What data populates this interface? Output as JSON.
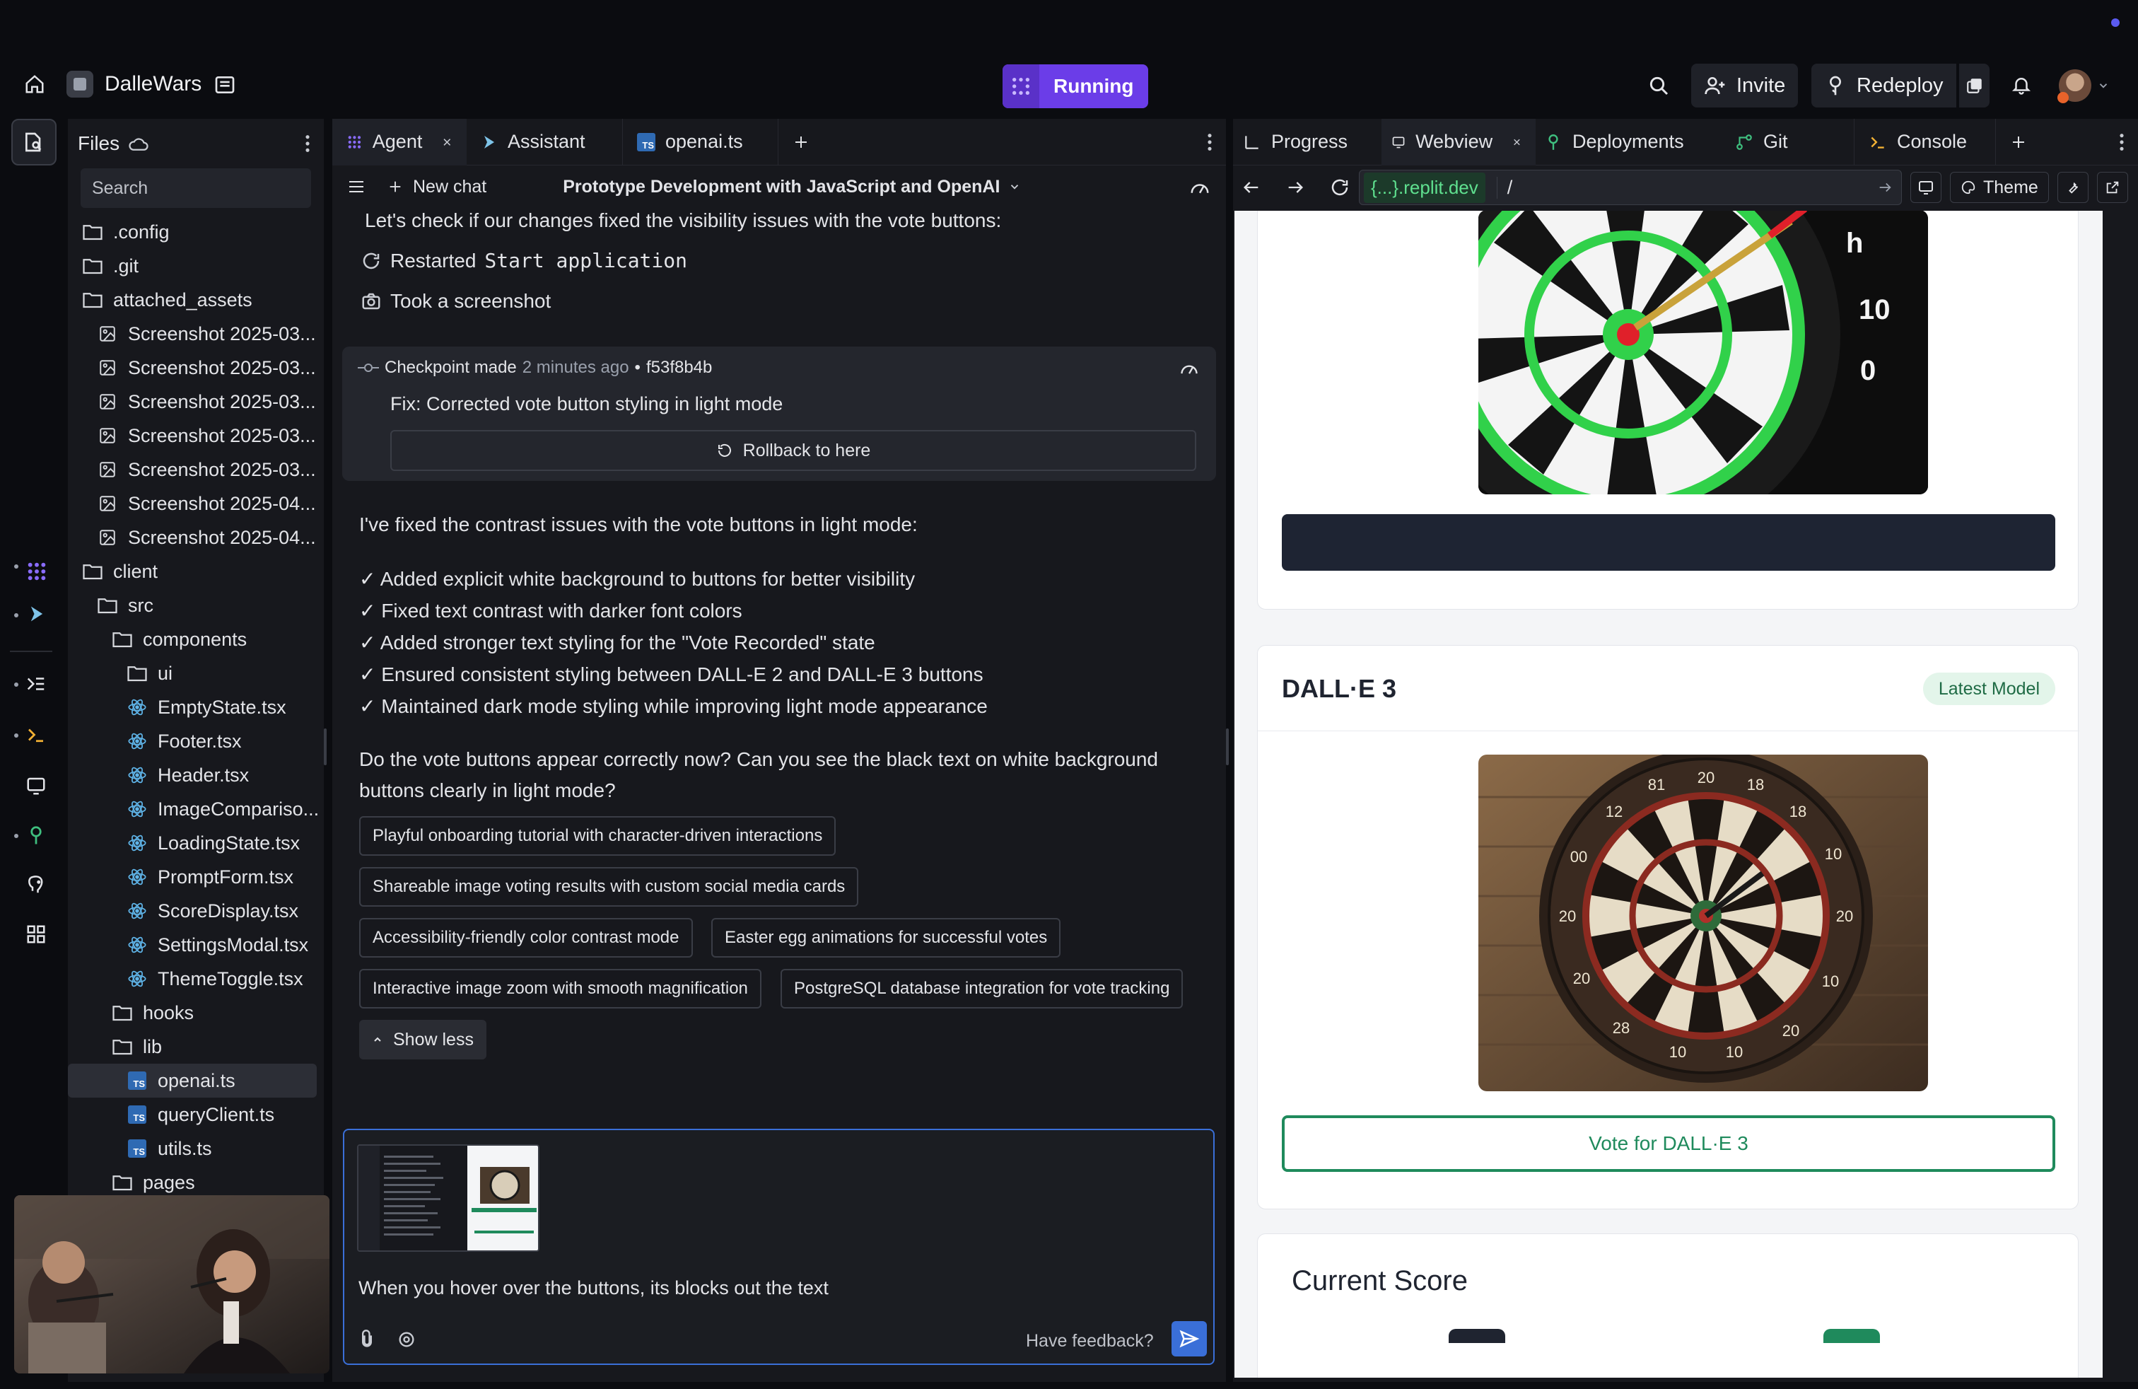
{
  "topbar": {
    "project_name": "DalleWars",
    "run_status": "Running",
    "invite_label": "Invite",
    "redeploy_label": "Redeploy"
  },
  "files": {
    "title": "Files",
    "search_placeholder": "Search",
    "tree": [
      {
        "name": ".config",
        "type": "folder",
        "depth": 0
      },
      {
        "name": ".git",
        "type": "folder",
        "depth": 0
      },
      {
        "name": "attached_assets",
        "type": "folder",
        "depth": 0
      },
      {
        "name": "Screenshot 2025-03...",
        "type": "image",
        "depth": 1
      },
      {
        "name": "Screenshot 2025-03...",
        "type": "image",
        "depth": 1
      },
      {
        "name": "Screenshot 2025-03...",
        "type": "image",
        "depth": 1
      },
      {
        "name": "Screenshot 2025-03...",
        "type": "image",
        "depth": 1
      },
      {
        "name": "Screenshot 2025-03...",
        "type": "image",
        "depth": 1
      },
      {
        "name": "Screenshot 2025-04...",
        "type": "image",
        "depth": 1
      },
      {
        "name": "Screenshot 2025-04...",
        "type": "image",
        "depth": 1
      },
      {
        "name": "client",
        "type": "folder",
        "depth": 0
      },
      {
        "name": "src",
        "type": "folder",
        "depth": 1
      },
      {
        "name": "components",
        "type": "folder",
        "depth": 2
      },
      {
        "name": "ui",
        "type": "folder",
        "depth": 3
      },
      {
        "name": "EmptyState.tsx",
        "type": "react",
        "depth": 3
      },
      {
        "name": "Footer.tsx",
        "type": "react",
        "depth": 3
      },
      {
        "name": "Header.tsx",
        "type": "react",
        "depth": 3
      },
      {
        "name": "ImageCompariso...",
        "type": "react",
        "depth": 3
      },
      {
        "name": "LoadingState.tsx",
        "type": "react",
        "depth": 3
      },
      {
        "name": "PromptForm.tsx",
        "type": "react",
        "depth": 3
      },
      {
        "name": "ScoreDisplay.tsx",
        "type": "react",
        "depth": 3
      },
      {
        "name": "SettingsModal.tsx",
        "type": "react",
        "depth": 3
      },
      {
        "name": "ThemeToggle.tsx",
        "type": "react",
        "depth": 3
      },
      {
        "name": "hooks",
        "type": "folder",
        "depth": 2
      },
      {
        "name": "lib",
        "type": "folder",
        "depth": 2
      },
      {
        "name": "openai.ts",
        "type": "ts",
        "depth": 3,
        "selected": true
      },
      {
        "name": "queryClient.ts",
        "type": "ts",
        "depth": 3
      },
      {
        "name": "utils.ts",
        "type": "ts",
        "depth": 3
      },
      {
        "name": "pages",
        "type": "folder",
        "depth": 2
      }
    ]
  },
  "agent": {
    "tabs": [
      {
        "label": "Agent",
        "active": true,
        "closable": true
      },
      {
        "label": "Assistant",
        "active": false
      },
      {
        "label": "openai.ts",
        "active": false
      }
    ],
    "new_chat_label": "New chat",
    "chat_title": "Prototype Development with JavaScript and OpenAI",
    "intro_line": "Let's check if our changes fixed the visibility issues with the vote buttons:",
    "action_restarted": "Restarted",
    "action_restarted_target": "Start application",
    "action_screenshot": "Took a screenshot",
    "checkpoint": {
      "label": "Checkpoint made",
      "time": "2 minutes ago",
      "separator": "•",
      "hash": "f53f8b4b",
      "message": "Fix: Corrected vote button styling in light mode",
      "rollback_label": "Rollback to here"
    },
    "summary": "I've fixed the contrast issues with the vote buttons in light mode:",
    "checklist": [
      "✓ Added explicit white background to buttons for better visibility",
      "✓ Fixed text contrast with darker font colors",
      "✓ Added stronger text styling for the \"Vote Recorded\" state",
      "✓ Ensured consistent styling between DALL-E 2 and DALL-E 3 buttons",
      "✓ Maintained dark mode styling while improving light mode appearance"
    ],
    "question_line1": "Do the vote buttons appear correctly now? Can you see the black text on white background",
    "question_line2": "buttons clearly in light mode?",
    "suggestions": [
      "Playful onboarding tutorial with character-driven interactions",
      "Shareable image voting results with custom social media cards",
      "Accessibility-friendly color contrast mode",
      "Easter egg animations for successful votes",
      "Interactive image zoom with smooth magnification",
      "PostgreSQL database integration for vote tracking"
    ],
    "show_less_label": "Show less",
    "composer_text": "When you hover over the buttons, its blocks out the text",
    "feedback_label": "Have feedback?"
  },
  "right": {
    "tabs": [
      {
        "label": "Progress",
        "active": false
      },
      {
        "label": "Webview",
        "active": true,
        "closable": true
      },
      {
        "label": "Deployments",
        "active": false
      },
      {
        "label": "Git",
        "active": false
      },
      {
        "label": "Console",
        "active": false
      }
    ],
    "url_host": "{...}.replit.dev",
    "url_path": "/",
    "theme_label": "Theme"
  },
  "webview": {
    "model_title": "DALL·E 3",
    "model_badge": "Latest Model",
    "vote_button": "Vote for DALL·E 3",
    "score_title": "Current Score",
    "colors": {
      "accent_green": "#1f8a5c",
      "badge_bg": "#e3f5ea",
      "dark_button": "#1e2433"
    }
  },
  "icons": {
    "rail": [
      "home-icon",
      "agent-icon",
      "assistant-icon",
      "changes-icon",
      "console-icon",
      "webview-icon",
      "deploy-icon",
      "postgres-icon",
      "grid-icon"
    ]
  }
}
